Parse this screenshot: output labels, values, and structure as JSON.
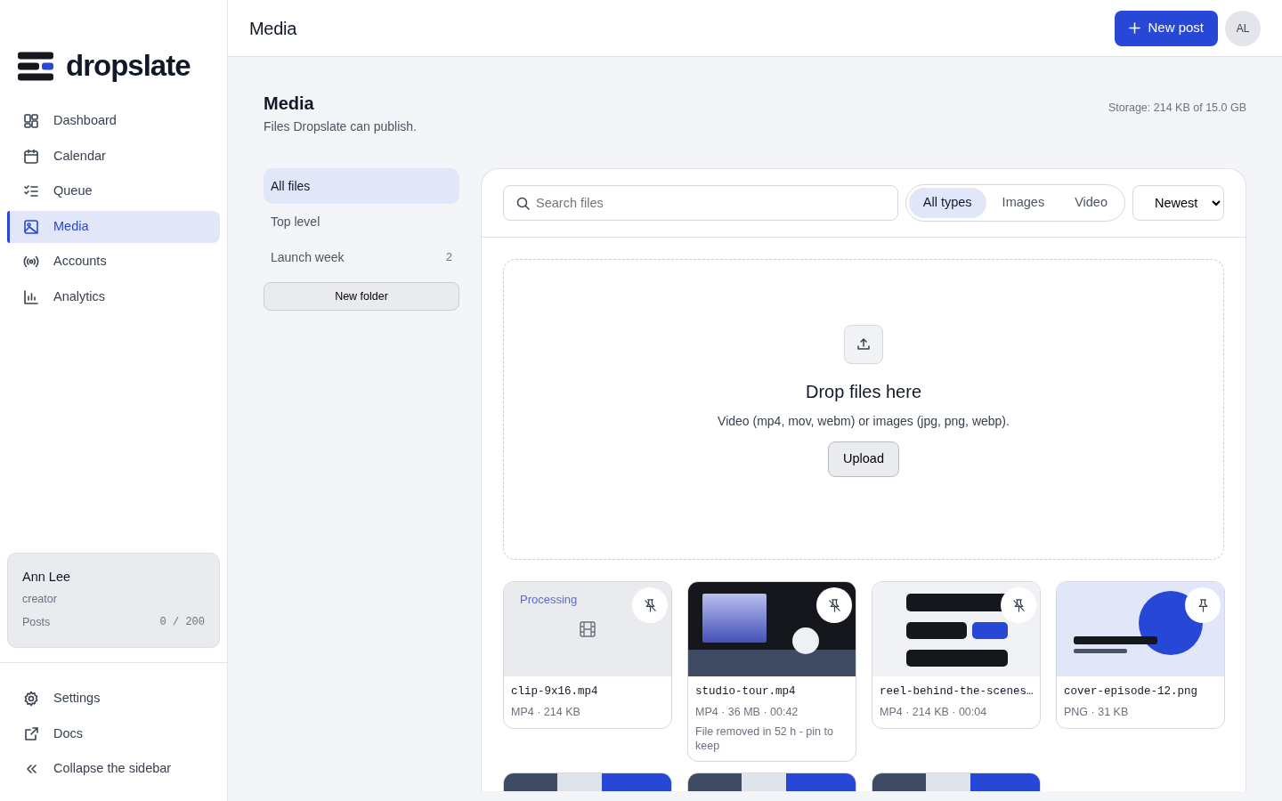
{
  "brand": {
    "name": "dropslate"
  },
  "sidebar": {
    "items": [
      {
        "label": "Dashboard",
        "selected": false
      },
      {
        "label": "Calendar",
        "selected": false
      },
      {
        "label": "Queue",
        "selected": false
      },
      {
        "label": "Media",
        "selected": true
      },
      {
        "label": "Accounts",
        "selected": false
      },
      {
        "label": "Analytics",
        "selected": false
      }
    ],
    "user": {
      "name": "Ann Lee",
      "role": "creator",
      "quota_label": "Posts",
      "quota": "0 / 200"
    },
    "footer_items": [
      {
        "label": "Settings"
      },
      {
        "label": "Docs"
      },
      {
        "label": "Collapse the sidebar"
      }
    ]
  },
  "header": {
    "title": "Media",
    "new_post": "New post",
    "avatar": "AL"
  },
  "page": {
    "title": "Media",
    "subtitle": "Files Dropslate can publish.",
    "storage": "Storage: 214 KB of 15.0 GB"
  },
  "folders": {
    "items": [
      {
        "label": "All files",
        "selected": true
      },
      {
        "label": "Top level",
        "selected": false
      },
      {
        "label": "Launch week",
        "count": "2",
        "selected": false
      }
    ],
    "new_folder": "New folder"
  },
  "toolbar": {
    "search": {
      "placeholder": "Search files"
    },
    "filters": [
      {
        "label": "All types",
        "selected": true
      },
      {
        "label": "Images",
        "selected": false
      },
      {
        "label": "Video",
        "selected": false
      }
    ],
    "sort": "Newest"
  },
  "dropzone": {
    "title": "Drop files here",
    "hint": "Video (mp4, mov, webm) or images (jpg, png, webp).",
    "button": "Upload"
  },
  "files": [
    {
      "kind": "processing",
      "status": "Processing",
      "name": "clip-9x16.mp4",
      "meta": "MP4 · 214 KB",
      "pinned": false
    },
    {
      "kind": "dark",
      "name": "studio-tour.mp4",
      "meta": "MP4 · 36 MB · 00:42",
      "note": "File removed in 52 h - pin to keep",
      "pinned": false
    },
    {
      "kind": "bars",
      "name": "reel-behind-the-scenes…",
      "meta": "MP4 · 214 KB · 00:04",
      "pinned": false
    },
    {
      "kind": "circle",
      "name": "cover-episode-12.png",
      "meta": "PNG · 31 KB",
      "pinned": true
    }
  ]
}
